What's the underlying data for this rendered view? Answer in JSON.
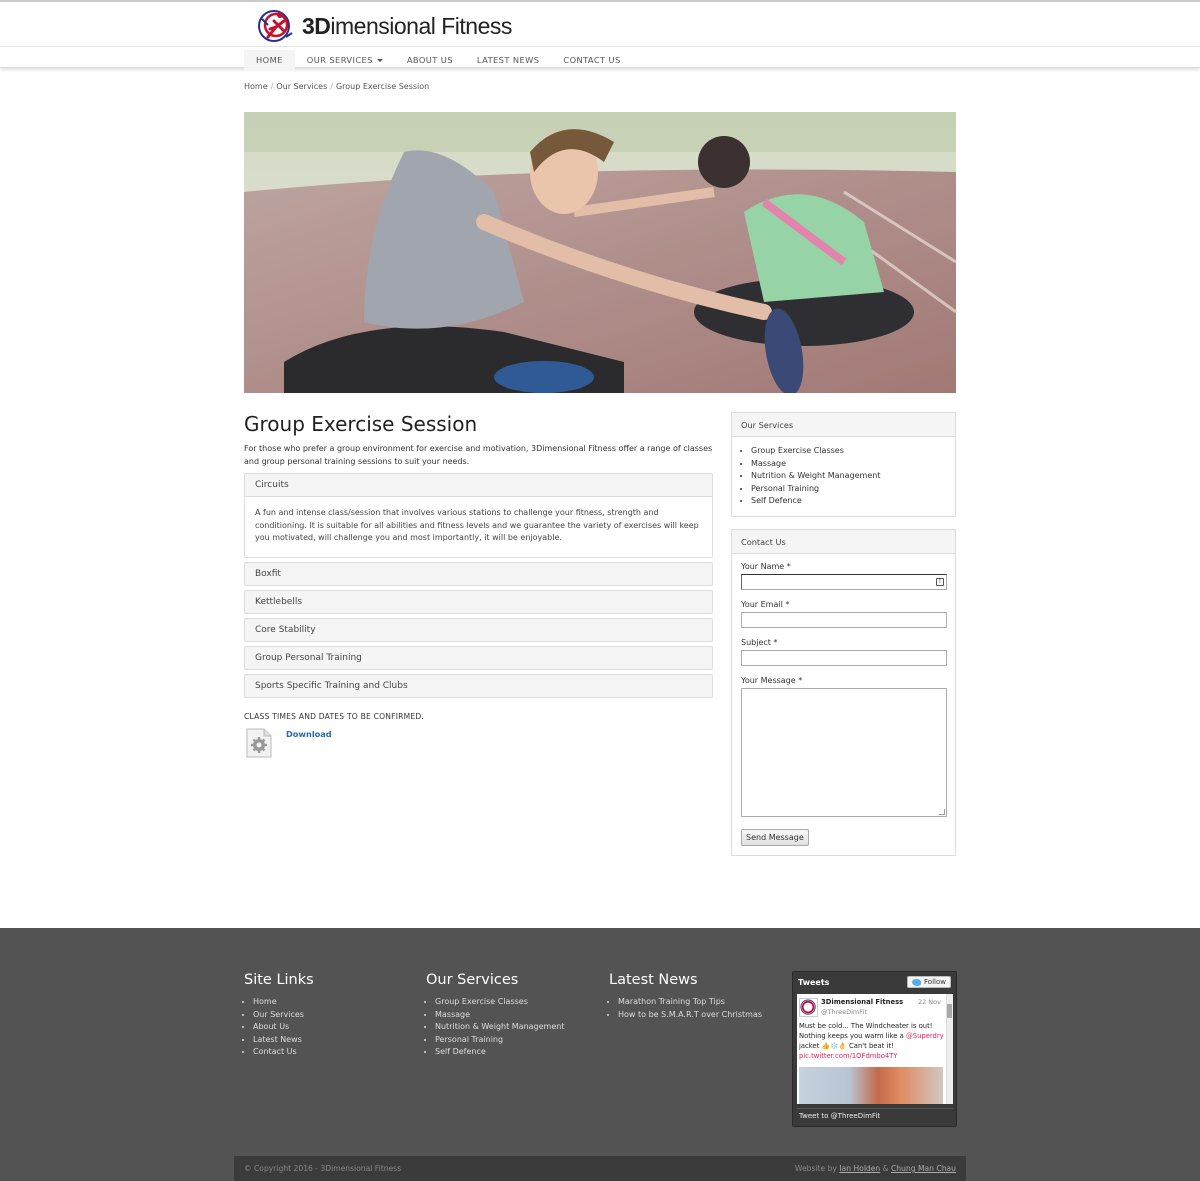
{
  "site": {
    "logo_text_bold": "3D",
    "logo_text_rest": "imensional Fitness"
  },
  "nav": {
    "items": [
      {
        "label": "HOME"
      },
      {
        "label": "OUR SERVICES"
      },
      {
        "label": "ABOUT US"
      },
      {
        "label": "LATEST NEWS"
      },
      {
        "label": "CONTACT US"
      }
    ]
  },
  "breadcrumb": {
    "items": [
      "Home",
      "Our Services",
      "Group Exercise Session"
    ],
    "separator": "/"
  },
  "main": {
    "title": "Group Exercise Session",
    "intro": "For those who prefer a group environment for exercise and motivation, 3Dimensional Fitness offer a range of classes and group personal training sessions to suit your needs.",
    "accordion": [
      {
        "title": "Circuits",
        "body": "A fun and intense class/session that involves various stations to challenge your fitness, strength and conditioning. It is suitable for all abilities and fitness levels and we guarantee the variety of exercises will keep you motivated, will challenge you and most importantly, it will be enjoyable.",
        "expanded": true
      },
      {
        "title": "Boxfit"
      },
      {
        "title": "Kettlebells"
      },
      {
        "title": "Core Stability"
      },
      {
        "title": "Group Personal Training"
      },
      {
        "title": "Sports Specific Training and Clubs"
      }
    ],
    "note": "CLASS TIMES AND DATES TO BE CONFIRMED.",
    "download_label": "Download"
  },
  "sidebar": {
    "services": {
      "title": "Our Services",
      "items": [
        "Group Exercise Classes",
        "Massage",
        "Nutrition & Weight Management",
        "Personal Training",
        "Self Defence"
      ]
    },
    "contact": {
      "title": "Contact Us",
      "name_label": "Your Name *",
      "email_label": "Your Email *",
      "subject_label": "Subject *",
      "message_label": "Your Message *",
      "submit_label": "Send Message"
    }
  },
  "footer": {
    "site_links": {
      "title": "Site Links",
      "items": [
        "Home",
        "Our Services",
        "About Us",
        "Latest News",
        "Contact Us"
      ]
    },
    "services": {
      "title": "Our Services",
      "items": [
        "Group Exercise Classes",
        "Massage",
        "Nutrition & Weight Management",
        "Personal Training",
        "Self Defence"
      ]
    },
    "news": {
      "title": "Latest News",
      "items": [
        "Marathon Training Top Tips",
        "How to be S.M.A.R.T over Christmas"
      ]
    },
    "tweets": {
      "title": "Tweets",
      "follow_label": "Follow",
      "author": "3Dimensional Fitness",
      "handle": "@ThreeDimFit",
      "date": "22 Nov",
      "text_1": "Must be cold... The Windcheater is out! Nothing keeps you warm like a",
      "mention": "@Superdry",
      "text_2": "jacket 👍❄️👌 Can't beat it!",
      "link": "pic.twitter.com/1OFdmbo4TY",
      "tweet_to": "Tweet to @ThreeDimFit"
    },
    "copyright": "© Copyright 2016 - 3Dimensional Fitness",
    "credit_prefix": "Website by",
    "credit_1": "Ian Holden",
    "credit_amp": "&",
    "credit_2": "Chung Man Chau"
  },
  "colors": {
    "footer_bg": "#535353",
    "link_blue": "#2a6aa8",
    "logo_red": "#c8102e",
    "logo_blue": "#2b2f8f"
  }
}
